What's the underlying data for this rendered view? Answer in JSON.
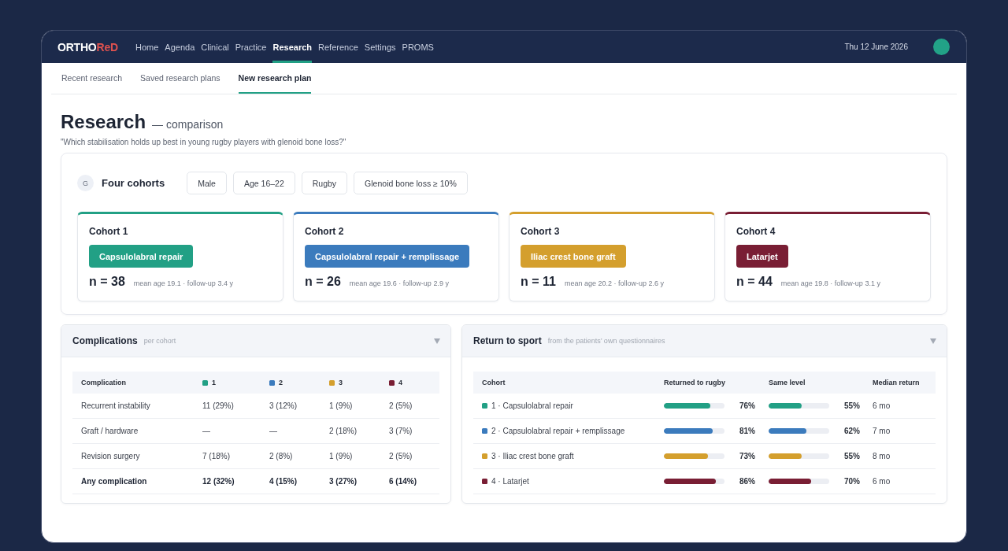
{
  "header": {
    "logo": {
      "main": "ORTHO",
      "accent": "ReD"
    },
    "nav": [
      {
        "label": "Home",
        "selected": false
      },
      {
        "label": "Agenda",
        "selected": false
      },
      {
        "label": "Clinical",
        "selected": false
      },
      {
        "label": "Practice",
        "selected": false
      },
      {
        "label": "Research",
        "selected": true
      },
      {
        "label": "Reference",
        "selected": false
      },
      {
        "label": "Settings",
        "selected": false
      },
      {
        "label": "PROMS",
        "selected": false
      }
    ],
    "date": "Thu 12 June 2026"
  },
  "tabs": [
    {
      "label": "Recent research",
      "selected": false
    },
    {
      "label": "Saved research plans",
      "selected": false
    },
    {
      "label": "New research plan",
      "selected": true
    }
  ],
  "page": {
    "title": "Research",
    "subtitle": "— comparison",
    "question": "\"Which stabilisation holds up best in young rugby players with glenoid bone loss?\""
  },
  "group": {
    "badge": "G",
    "title": "Four cohorts",
    "filters": [
      "Male",
      "Age 16–22",
      "Rugby",
      "Glenoid bone loss ≥ 10%"
    ],
    "cohorts": [
      {
        "title": "Cohort 1",
        "procedure": "Capsulolabral repair",
        "color": "#22a085",
        "count": "n = 38",
        "meta": "mean age 19.1 · follow-up 3.4 y"
      },
      {
        "title": "Cohort 2",
        "procedure": "Capsulolabral repair + remplissage",
        "color": "#3b7bbd",
        "count": "n = 26",
        "meta": "mean age 19.6 · follow-up 2.9 y"
      },
      {
        "title": "Cohort 3",
        "procedure": "Iliac crest bone graft",
        "color": "#d49f2d",
        "count": "n = 11",
        "meta": "mean age 20.2 · follow-up 2.6 y"
      },
      {
        "title": "Cohort 4",
        "procedure": "Latarjet",
        "color": "#791e34",
        "count": "n = 44",
        "meta": "mean age 19.8 · follow-up 3.1 y"
      }
    ]
  },
  "complications": {
    "title": "Complications",
    "subtitle": "per cohort",
    "columns": [
      {
        "label": "Complication"
      },
      {
        "label": "1",
        "color": "#22a085"
      },
      {
        "label": "2",
        "color": "#3b7bbd"
      },
      {
        "label": "3",
        "color": "#d49f2d"
      },
      {
        "label": "4",
        "color": "#791e34"
      }
    ],
    "rows": [
      {
        "kind": "item",
        "label": "Recurrent instability",
        "values": [
          "11 (29%)",
          "3 (12%)",
          "1 (9%)",
          "2 (5%)"
        ]
      },
      {
        "kind": "item",
        "label": "Graft / hardware",
        "values": [
          "—",
          "—",
          "2 (18%)",
          "3 (7%)"
        ]
      },
      {
        "kind": "item",
        "label": "Revision surgery",
        "values": [
          "7 (18%)",
          "2 (8%)",
          "1 (9%)",
          "2 (5%)"
        ]
      },
      {
        "kind": "total",
        "label": "Any complication",
        "values": [
          "12 (32%)",
          "4 (15%)",
          "3 (27%)",
          "6 (14%)"
        ]
      }
    ]
  },
  "return_to_sport": {
    "title": "Return to sport",
    "subtitle": "from the patients’ own questionnaires",
    "columns": [
      "Cohort",
      "Returned to rugby",
      "Same level",
      "Median return"
    ],
    "rows": [
      {
        "cohort": "1 · Capsulolabral repair",
        "color": "#22a085",
        "returned": {
          "level": 0.76,
          "reading": "76%"
        },
        "same_level": {
          "level": 0.55,
          "reading": "55%"
        },
        "median": "6 mo"
      },
      {
        "cohort": "2 · Capsulolabral repair + remplissage",
        "color": "#3b7bbd",
        "returned": {
          "level": 0.81,
          "reading": "81%"
        },
        "same_level": {
          "level": 0.62,
          "reading": "62%"
        },
        "median": "7 mo"
      },
      {
        "cohort": "3 · Iliac crest bone graft",
        "color": "#d49f2d",
        "returned": {
          "level": 0.73,
          "reading": "73%"
        },
        "same_level": {
          "level": 0.55,
          "reading": "55%"
        },
        "median": "8 mo"
      },
      {
        "cohort": "4 · Latarjet",
        "color": "#791e34",
        "returned": {
          "level": 0.86,
          "reading": "86%"
        },
        "same_level": {
          "level": 0.7,
          "reading": "70%"
        },
        "median": "6 mo"
      }
    ]
  }
}
